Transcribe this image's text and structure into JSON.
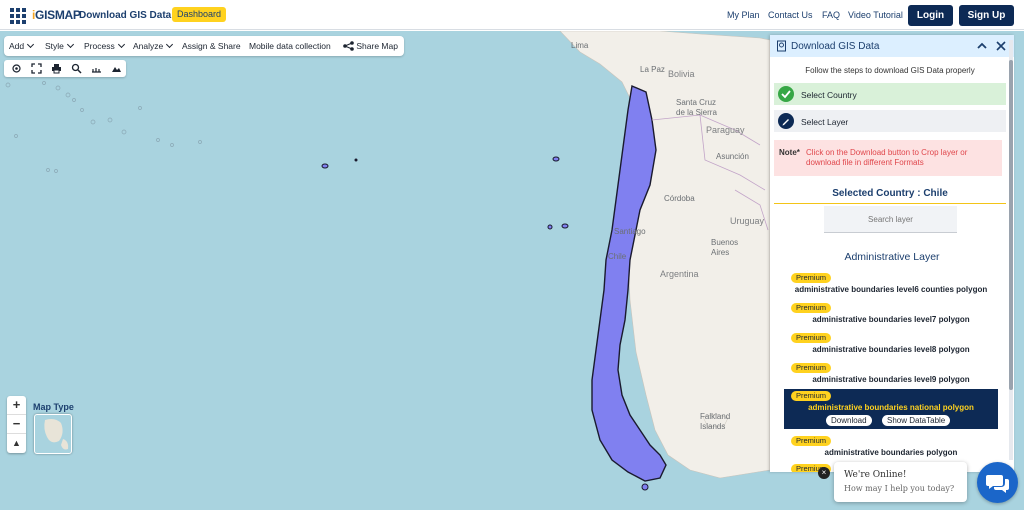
{
  "header": {
    "logo_prefix": "i",
    "logo_text": "GISMAP",
    "title": "Download GIS Data",
    "dashboard": "Dashboard",
    "nav": [
      "My Plan",
      "Contact Us",
      "FAQ",
      "Video Tutorial"
    ],
    "login": "Login",
    "signup": "Sign Up"
  },
  "toolbar": {
    "items": [
      "Add",
      "Style",
      "Process",
      "Analyze",
      "Assign & Share",
      "Mobile data collection",
      "Share Map"
    ]
  },
  "map": {
    "labels": [
      "Lima",
      "La Paz",
      "Bolivia",
      "Santa Cruz de la Sierra",
      "Paraguay",
      "Asunción",
      "Córdoba",
      "Uruguay",
      "Buenos Aires",
      "Argentina",
      "Chile",
      "Santiago",
      "Falkland Islands"
    ],
    "map_type": "Map Type",
    "highlight_color": "#8080f0"
  },
  "panel": {
    "title": "Download GIS Data",
    "subtitle": "Follow the steps to download GIS Data properly",
    "step1": "Select Country",
    "step2": "Select Layer",
    "note_label": "Note*",
    "note_text": "Click on the Download button to Crop layer or download file in different Formats",
    "selected_country": "Selected Country : Chile",
    "search_placeholder": "Search layer",
    "admin_title": "Administrative Layer",
    "badge": "Premium",
    "layers": [
      "administrative boundaries level6 counties polygon",
      "administrative boundaries level7 polygon",
      "administrative boundaries level8 polygon",
      "administrative boundaries level9 polygon",
      "administrative boundaries national polygon",
      "administrative boundaries polygon"
    ],
    "download": "Download",
    "show_table": "Show DataTable"
  },
  "chat": {
    "online": "We're Online!",
    "help": "How may I help you today?"
  }
}
